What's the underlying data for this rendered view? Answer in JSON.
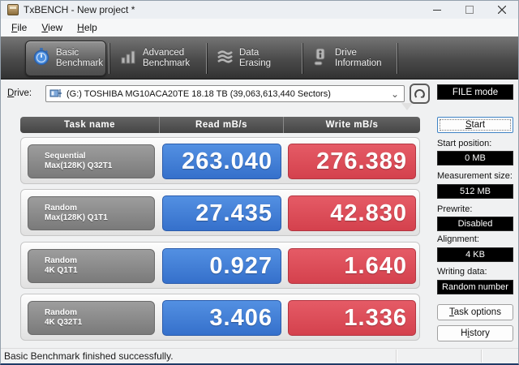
{
  "window": {
    "title": "TxBENCH - New project *"
  },
  "icons": {
    "minimize": "–",
    "maximize": "▢",
    "close": "✕",
    "combo_chevron": "⌄",
    "overflow_arrow": "▼",
    "names": [
      "app-icon",
      "stopwatch-icon",
      "bar-chart-icon",
      "eraser-icon",
      "drive-info-icon",
      "drive-icon",
      "refresh-icon"
    ]
  },
  "menu": {
    "items": [
      {
        "pre": "",
        "key": "F",
        "rest": "ile"
      },
      {
        "pre": "",
        "key": "V",
        "rest": "iew"
      },
      {
        "pre": "",
        "key": "H",
        "rest": "elp"
      }
    ]
  },
  "toolbar": {
    "tabs": [
      {
        "line1": "Basic",
        "line2": "Benchmark",
        "selected": true
      },
      {
        "line1": "Advanced",
        "line2": "Benchmark",
        "selected": false
      },
      {
        "line1": "Data Erasing",
        "line2": "",
        "selected": false
      },
      {
        "line1": "Drive",
        "line2": "Information",
        "selected": false
      }
    ]
  },
  "drive": {
    "label_key": "D",
    "label_rest": "rive:",
    "value": "(G:) TOSHIBA MG10ACA20TE  18.18 TB (39,063,613,440 Sectors)",
    "file_mode_label": "FILE mode"
  },
  "table": {
    "headers": [
      "Task name",
      "Read mB/s",
      "Write mB/s"
    ],
    "rows": [
      {
        "task_line1": "Sequential",
        "task_line2": "Max(128K) Q32T1",
        "read": "263.040",
        "write": "276.389"
      },
      {
        "task_line1": "Random",
        "task_line2": "Max(128K) Q1T1",
        "read": "27.435",
        "write": "42.830"
      },
      {
        "task_line1": "Random",
        "task_line2": "4K Q1T1",
        "read": "0.927",
        "write": "1.640"
      },
      {
        "task_line1": "Random",
        "task_line2": "4K Q32T1",
        "read": "3.406",
        "write": "1.336"
      }
    ]
  },
  "sidebar": {
    "start": {
      "pre": "",
      "key": "S",
      "rest": "tart"
    },
    "fields": [
      {
        "label": "Start position:",
        "value": "0 MB"
      },
      {
        "label": "Measurement size:",
        "value": "512 MB"
      },
      {
        "label": "Prewrite:",
        "value": "Disabled"
      },
      {
        "label": "Alignment:",
        "value": "4 KB"
      },
      {
        "label": "Writing data:",
        "value": "Random number"
      }
    ],
    "task_options": {
      "pre": "",
      "key": "T",
      "rest": "ask options"
    },
    "history": {
      "pre": "H",
      "key": "i",
      "rest": "story"
    }
  },
  "statusbar": {
    "message": "Basic Benchmark finished successfully."
  },
  "colors": {
    "read_blue": "#3d7ed8",
    "write_red": "#d9444f",
    "task_gray": "#8a8a8a",
    "header_dark": "#4f4f4f",
    "window_border_bottom": "#1f3a66",
    "accent_stopwatch": "#4a8ee0"
  }
}
